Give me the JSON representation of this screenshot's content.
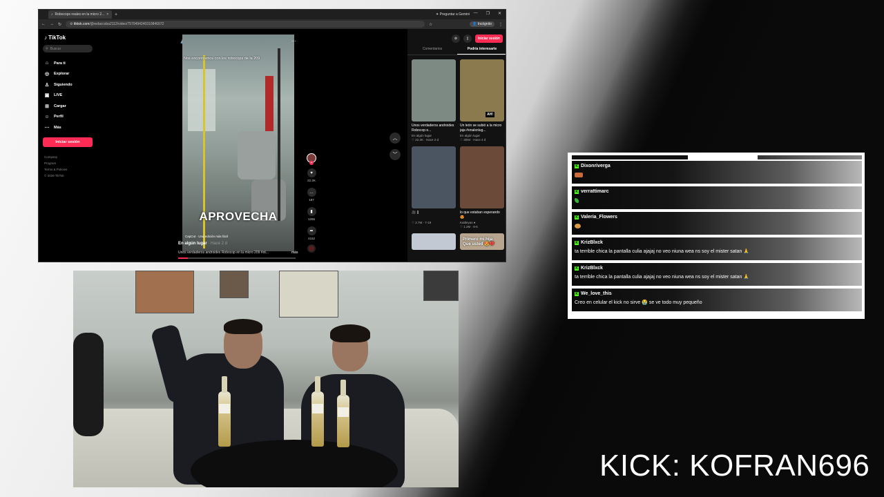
{
  "browser": {
    "tab_title": "Robocops reales en la micro 2...",
    "gemini_label": "Preguntar a Gemini",
    "url_domain": "tiktok.com",
    "url_path": "/@redaccsba2112/video/7570494240310846972",
    "incognito_label": "Incógnito"
  },
  "tiktok": {
    "logo": "TikTok",
    "search_placeholder": "Buscar",
    "nav": [
      {
        "label": "Para ti",
        "icon": "home-icon"
      },
      {
        "label": "Explorar",
        "icon": "compass-icon"
      },
      {
        "label": "Siguiendo",
        "icon": "user-icon"
      },
      {
        "label": "LIVE",
        "icon": "live-icon"
      },
      {
        "label": "Cargar",
        "icon": "upload-icon"
      },
      {
        "label": "Perfil",
        "icon": "profile-icon"
      },
      {
        "label": "Más",
        "icon": "more-icon"
      }
    ],
    "login_button": "Iniciar sesión",
    "footer": [
      "Company",
      "Program",
      "Terms & Policies",
      "© 2026 TikTok"
    ],
    "video": {
      "overlay_text": "Nos encontramos con los robocops de la 209",
      "caption": "APROVECHA",
      "capcut": "CapCut · Una edición más fácil",
      "location": "En algún lugar",
      "time_ago": "· Hace 2 d",
      "description": "Unos verdaderos androides Robocop en la micro 209 #ot...",
      "more": "más",
      "likes": "22.2K",
      "comments": "187",
      "saves": "1255",
      "shares": "4152"
    },
    "right_panel": {
      "login_button": "Iniciar sesión",
      "tabs": [
        "Comentarios",
        "Podría interesarte"
      ],
      "cards": [
        {
          "title": "Unos verdaderos androides Robocop e...",
          "author": "En algún lugar",
          "stats": "♡ 22.2K · Hace 2 d",
          "tag": "",
          "color": "#7d8a84"
        },
        {
          "title": "Un león se subió a la micro jaja #enalsnlug...",
          "author": "En algún lugar",
          "stats": "♡ 3094 · Hace 4 d",
          "tag": "AH!",
          "color": "#8a7a4e"
        },
        {
          "title": "🎥 ||",
          "author": "",
          "stats": "♡ 2.7M · 7-19",
          "tag": "",
          "color": "#4b5561"
        },
        {
          "title": "lo que estaban esperando 😍",
          "author": "Kattleyas ●",
          "stats": "♡ 1.2M · 8-6",
          "tag": "",
          "color": "#6b4a3a"
        },
        {
          "title": "",
          "author": "",
          "stats": "",
          "tag": "",
          "color": "#c2c9d3"
        },
        {
          "title": "",
          "author": "",
          "stats": "",
          "tag": "Primero mi hija Que usted 😍💔",
          "color": "#b7a58f"
        }
      ]
    }
  },
  "chat": {
    "messages": [
      {
        "user": "Dixonriverga",
        "text": "",
        "emote": "emote"
      },
      {
        "user": "verrattimarc",
        "text": "",
        "emote": "leaf"
      },
      {
        "user": "Valeria_Flowers",
        "text": "",
        "emote": "dot"
      },
      {
        "user": "KrizBlxck",
        "text": "ta terrible chica la pantalla culia ajajaj no veo niuna wea ns soy el mister satan 🙏",
        "emote": ""
      },
      {
        "user": "KrizBlxck",
        "text": "ta terrible chica la pantalla culia ajajaj no veo niuna wea ns soy el mister satan 🙏",
        "emote": ""
      },
      {
        "user": "We_love_this",
        "text": "Creo en celular el kick no sirve 😭 se ve todo muy pequeño",
        "emote": ""
      }
    ]
  },
  "brand": "KICK: KOFRAN696"
}
